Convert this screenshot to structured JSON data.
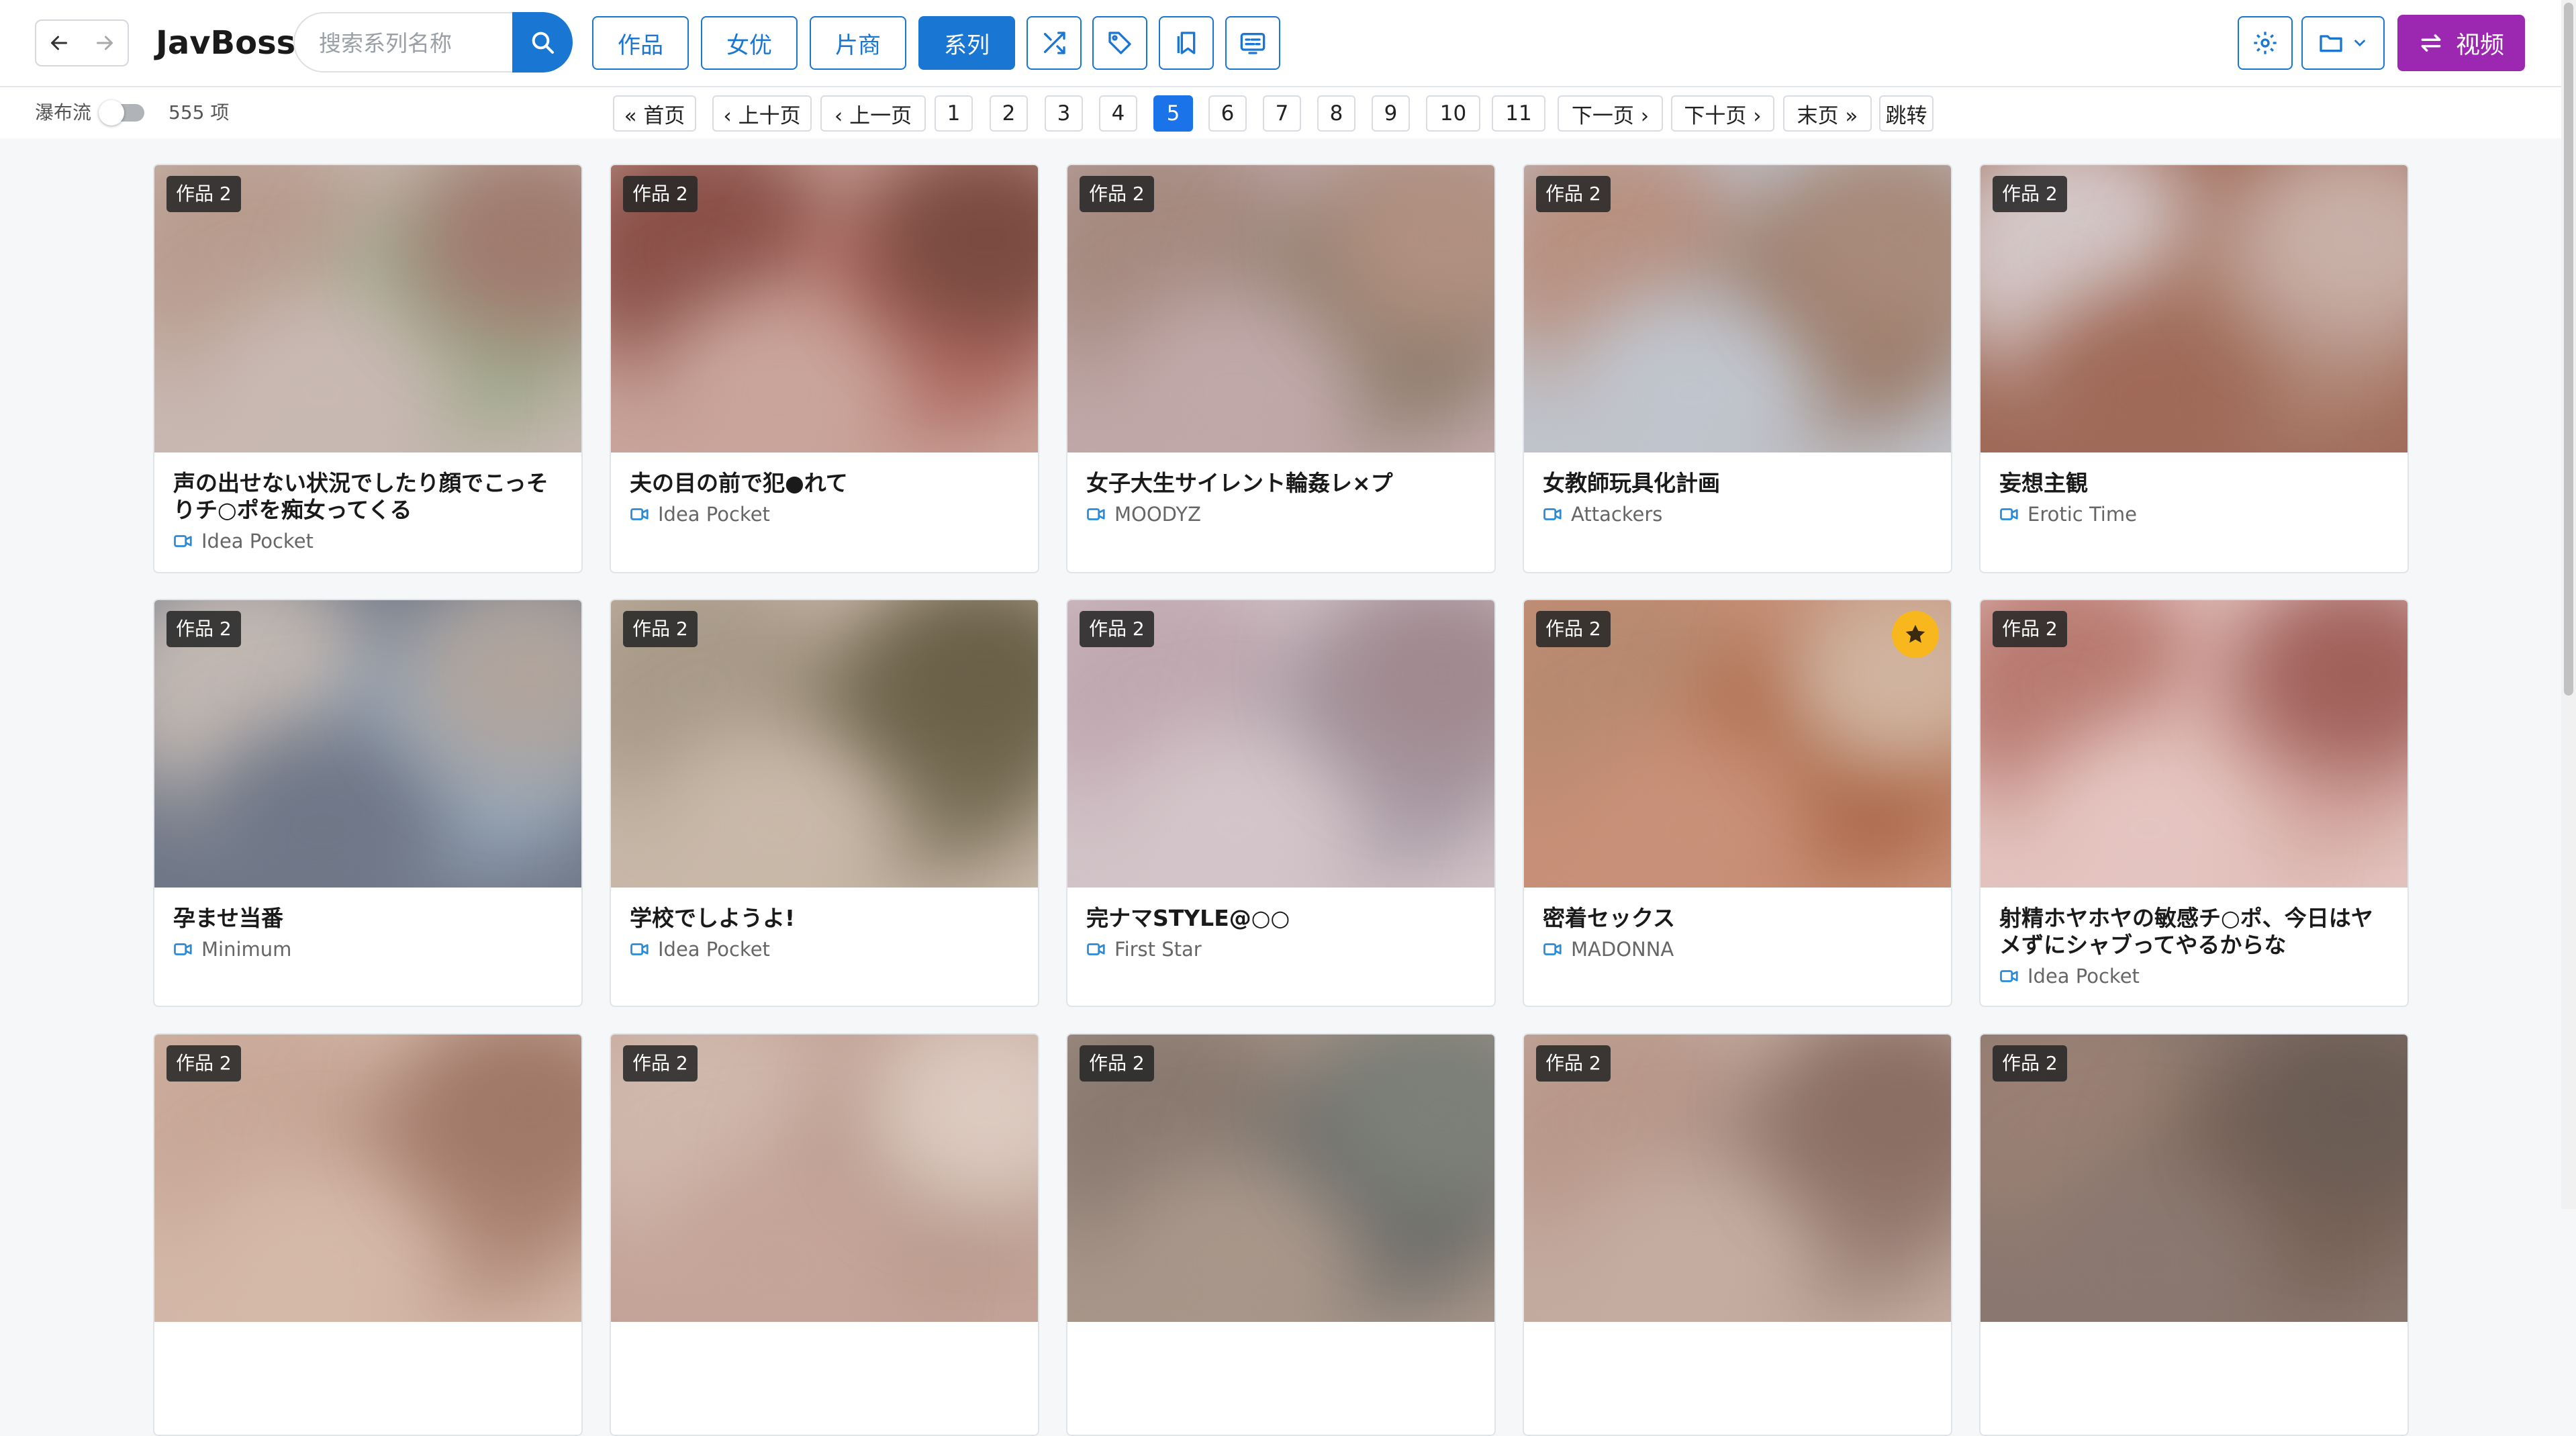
{
  "app": {
    "brand": "JavBoss"
  },
  "search": {
    "placeholder": "搜索系列名称"
  },
  "tabs": [
    {
      "label": "作品",
      "active": false
    },
    {
      "label": "女优",
      "active": false
    },
    {
      "label": "片商",
      "active": false
    },
    {
      "label": "系列",
      "active": true
    }
  ],
  "header_icons": [
    "shuffle-icon",
    "tag-icon",
    "bookmarks-icon",
    "subtitles-icon",
    "gear-icon",
    "folder-icon"
  ],
  "video_button": {
    "label": "视频"
  },
  "toolbar": {
    "waterfall_label": "瀑布流",
    "waterfall_on": false,
    "count": "555 项"
  },
  "pagination": [
    {
      "label": "« 首页"
    },
    {
      "label": "‹ 上十页"
    },
    {
      "label": "‹ 上一页"
    },
    {
      "label": "1"
    },
    {
      "label": "2"
    },
    {
      "label": "3"
    },
    {
      "label": "4"
    },
    {
      "label": "5",
      "active": true
    },
    {
      "label": "6"
    },
    {
      "label": "7"
    },
    {
      "label": "8"
    },
    {
      "label": "9"
    },
    {
      "label": "10"
    },
    {
      "label": "11"
    },
    {
      "label": "下一页 ›"
    },
    {
      "label": "下十页 ›"
    },
    {
      "label": "末页 »"
    },
    {
      "label": "跳转"
    }
  ],
  "colors": {
    "primary": "#1976d2",
    "video": "#9c27b0",
    "favorite": "#f9b71e",
    "page_active": "#1a73e8"
  },
  "cards": [
    {
      "badge": "作品 2",
      "title": "声の出せない状況でしたり顔でこっそりチ○ポを痴女ってくる",
      "studio": "Idea Pocket",
      "favorite": false
    },
    {
      "badge": "作品 2",
      "title": "夫の目の前で犯●れて",
      "studio": "Idea Pocket",
      "favorite": false
    },
    {
      "badge": "作品 2",
      "title": "女子大生サイレント輪姦レ×プ",
      "studio": "MOODYZ",
      "favorite": false
    },
    {
      "badge": "作品 2",
      "title": "女教師玩具化計画",
      "studio": "Attackers",
      "favorite": false
    },
    {
      "badge": "作品 2",
      "title": "妄想主観",
      "studio": "Erotic Time",
      "favorite": false
    },
    {
      "badge": "作品 2",
      "title": "孕ませ当番",
      "studio": "Minimum",
      "favorite": false
    },
    {
      "badge": "作品 2",
      "title": "学校でしようよ!",
      "studio": "Idea Pocket",
      "favorite": false
    },
    {
      "badge": "作品 2",
      "title": "完ナマSTYLE@○○",
      "studio": "First Star",
      "favorite": false
    },
    {
      "badge": "作品 2",
      "title": "密着セックス",
      "studio": "MADONNA",
      "favorite": true
    },
    {
      "badge": "作品 2",
      "title": "射精ホヤホヤの敏感チ○ポ、今日はヤメずにシャブってやるからな",
      "studio": "Idea Pocket",
      "favorite": false
    },
    {
      "badge": "作品 2",
      "title": "",
      "studio": "",
      "favorite": false
    },
    {
      "badge": "作品 2",
      "title": "",
      "studio": "",
      "favorite": false
    },
    {
      "badge": "作品 2",
      "title": "",
      "studio": "",
      "favorite": false
    },
    {
      "badge": "作品 2",
      "title": "",
      "studio": "",
      "favorite": false
    },
    {
      "badge": "作品 2",
      "title": "",
      "studio": "",
      "favorite": false
    }
  ]
}
